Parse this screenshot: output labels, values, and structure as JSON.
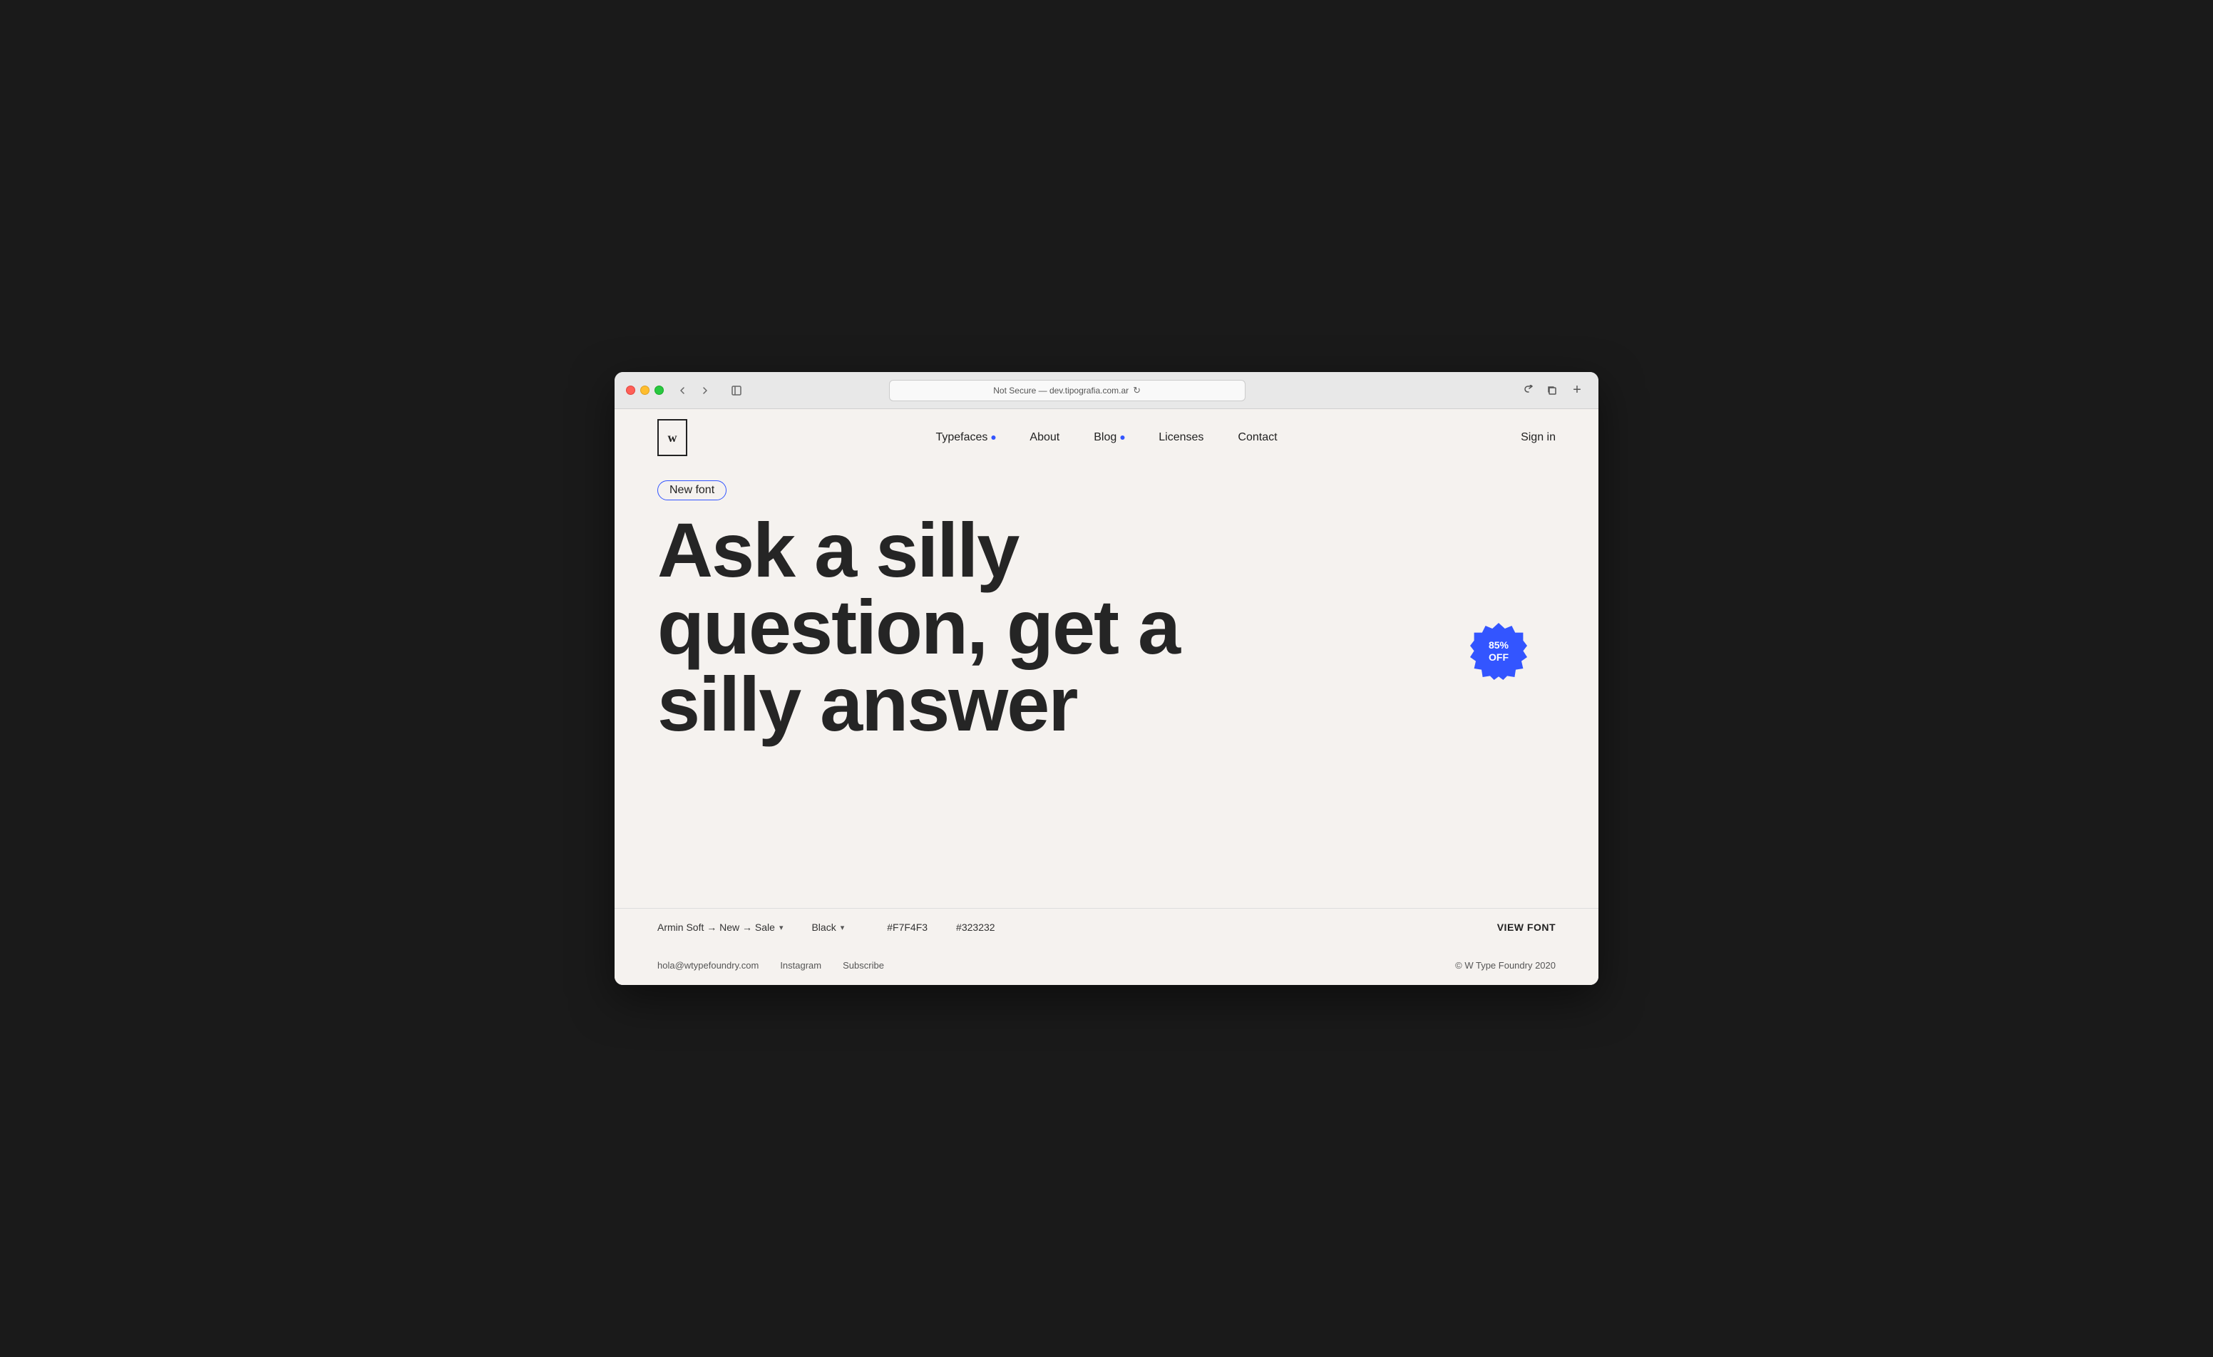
{
  "browser": {
    "address": "Not Secure — dev.tipografia.com.ar",
    "tab_label": "dev.tipografia.com.ar"
  },
  "nav": {
    "logo_letter": "w",
    "links": [
      {
        "label": "Typefaces",
        "has_dot": true
      },
      {
        "label": "About",
        "has_dot": false
      },
      {
        "label": "Blog",
        "has_dot": true
      },
      {
        "label": "Licenses",
        "has_dot": false
      },
      {
        "label": "Contact",
        "has_dot": false
      }
    ],
    "sign_in": "Sign in"
  },
  "hero": {
    "badge": "New font",
    "headline_line1": "Ask a silly",
    "headline_line2": "question, get a",
    "headline_line3": "silly answer"
  },
  "discount": {
    "percent": "85%",
    "off": "OFF"
  },
  "toolbar": {
    "font_name": "Armin Soft → New → Sale",
    "weight": "Black",
    "bg_color": "#F7F4F3",
    "text_color": "#323232",
    "view_font": "VIEW FONT"
  },
  "footer": {
    "email": "hola@wtypefoundry.com",
    "instagram": "Instagram",
    "subscribe": "Subscribe",
    "copyright": "© W Type Foundry 2020"
  }
}
